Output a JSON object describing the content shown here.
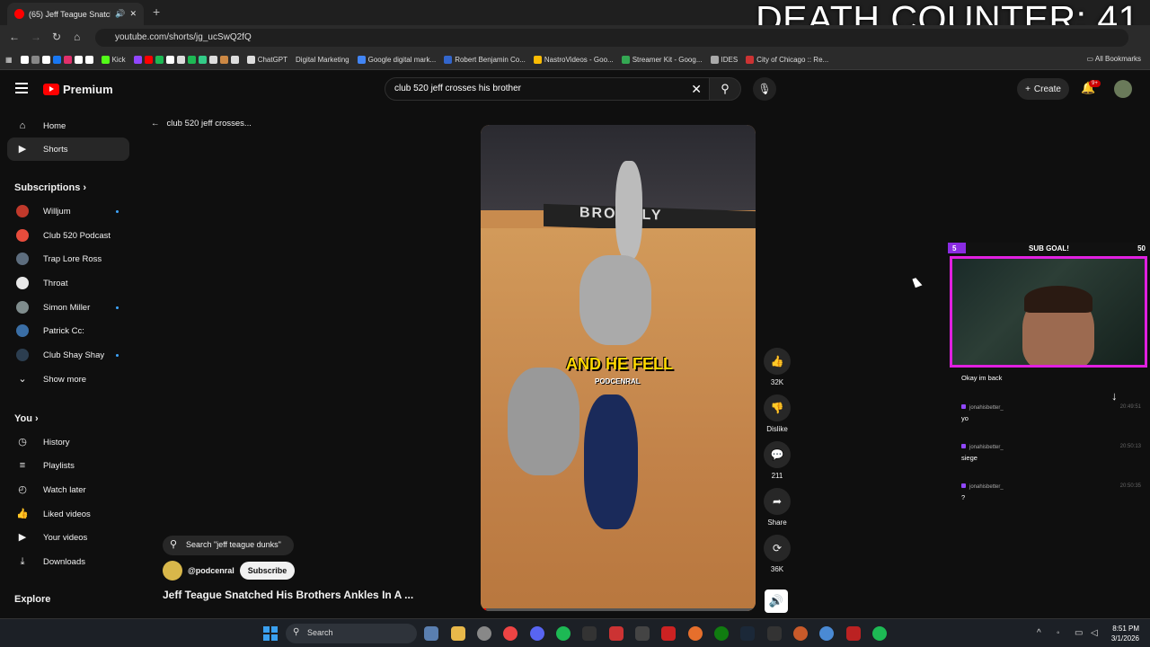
{
  "browser": {
    "tab_title": "(65) Jeff Teague Snatched Hi",
    "url": "youtube.com/shorts/jg_ucSwQ2fQ",
    "bookmarks": [
      "Kick",
      "ChatGPT",
      "Digital Marketing",
      "Google digital mark...",
      "Robert Benjamin Co...",
      "NastroVideos - Goo...",
      "Streamer Kit - Goog...",
      "IDES",
      "City of Chicago :: Re..."
    ],
    "all_bookmarks": "All Bookmarks"
  },
  "overlay": {
    "death_counter": "DEATH COUNTER: 41",
    "sub_goal": {
      "current": "5",
      "label": "SUB GOAL!",
      "target": "50"
    }
  },
  "youtube": {
    "logo": "Premium",
    "search_value": "club 520 jeff crosses his brother",
    "create_label": "Create",
    "notif_badge": "9+",
    "back_label": "club 520 jeff crosses...",
    "nav": [
      {
        "label": "Home",
        "icon": "home-icon"
      },
      {
        "label": "Shorts",
        "icon": "shorts-icon"
      }
    ],
    "subscriptions_label": "Subscriptions",
    "subscriptions": [
      {
        "label": "Willjum",
        "color": "#c0392b"
      },
      {
        "label": "Club 520 Podcast",
        "color": "#e74c3c"
      },
      {
        "label": "Trap Lore Ross",
        "color": "#5d6d7e"
      },
      {
        "label": "Throat",
        "color": "#e8e8e8"
      },
      {
        "label": "Simon Miller",
        "color": "#7f8c8d"
      },
      {
        "label": "Patrick Cc:",
        "color": "#3a6ea5"
      },
      {
        "label": "Club Shay Shay",
        "color": "#2c3e50"
      }
    ],
    "show_more": "Show more",
    "you_label": "You",
    "you_items": [
      {
        "label": "History",
        "icon": "history-icon"
      },
      {
        "label": "Playlists",
        "icon": "playlists-icon"
      },
      {
        "label": "Watch later",
        "icon": "watch-later-icon"
      },
      {
        "label": "Liked videos",
        "icon": "thumbs-up-icon"
      },
      {
        "label": "Your videos",
        "icon": "your-videos-icon"
      },
      {
        "label": "Downloads",
        "icon": "download-icon"
      }
    ],
    "explore_label": "Explore",
    "video": {
      "caption_main": "AND HE ",
      "caption_highlight": "FELL",
      "caption_sub": "PODCENRAL",
      "arena_text": "BROOKLY",
      "progress": 0.02
    },
    "actions": {
      "likes": "32K",
      "dislike": "Dislike",
      "comments": "211",
      "share": "Share",
      "remix": "36K"
    },
    "search_chip": "Search \"jeff teague dunks\"",
    "channel": "@podcenral",
    "subscribe": "Subscribe",
    "title": "Jeff Teague Snatched His Brothers Ankles In A ..."
  },
  "chat": [
    {
      "user": "",
      "text": "Okay im back",
      "time": ""
    },
    {
      "user": "jonahisbetter_",
      "text": "yo",
      "time": "20:49:51"
    },
    {
      "user": "jonahisbetter_",
      "text": "siege",
      "time": "20:50:13"
    },
    {
      "user": "jonahisbetter_",
      "text": "?",
      "time": "20:50:35"
    }
  ],
  "taskbar": {
    "search": "Search",
    "time": "8:51 PM",
    "date": "3/1/2026"
  }
}
